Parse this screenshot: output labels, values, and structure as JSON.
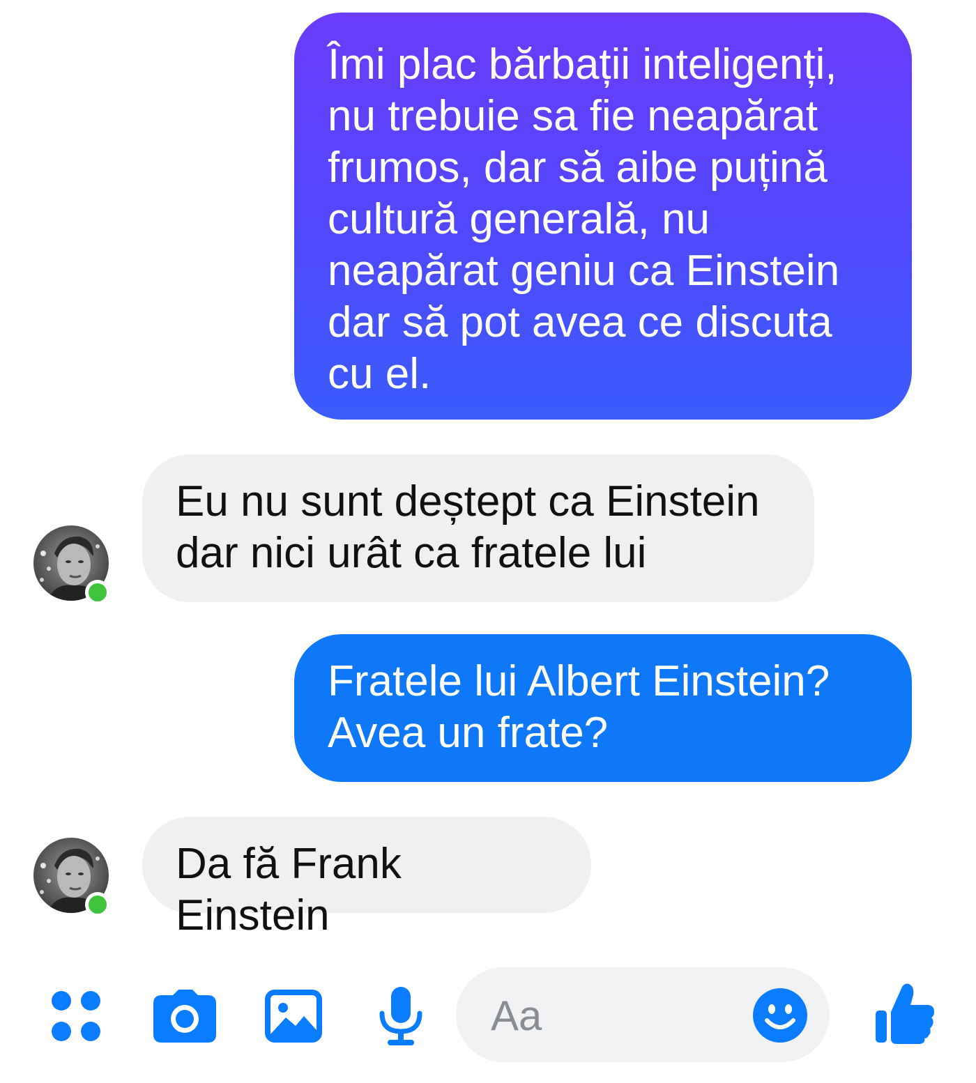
{
  "conversation": {
    "messages": [
      {
        "direction": "outgoing",
        "text": "Îmi plac bărbații inteligenți,\nnu trebuie sa fie neapărat\nfrumos, dar să aibe puțină\ncultură generală, nu\nneapărat geniu  ca Einstein\ndar să pot avea ce discuta\ncu el."
      },
      {
        "direction": "incoming",
        "text": "Eu nu sunt deștept ca Einstein\ndar nici urât ca fratele lui"
      },
      {
        "direction": "outgoing",
        "text": "Fratele lui Albert Einstein?\nAvea un frate?"
      },
      {
        "direction": "incoming",
        "text": "Da fă Frank Einstein"
      }
    ],
    "contact": {
      "online": true
    }
  },
  "composer": {
    "placeholder": "Aa",
    "icons": [
      "apps-icon",
      "camera-icon",
      "gallery-icon",
      "microphone-icon",
      "emoji-icon",
      "thumbs-up-icon"
    ]
  },
  "colors": {
    "accent": "#0f78f9",
    "outgoing_gradient_top": "#6a3cfa",
    "outgoing_gradient_bottom": "#3a5cfb",
    "incoming_bubble": "#f0f0f0",
    "online_dot": "#3fc33a",
    "icon": "#0a7cff"
  }
}
